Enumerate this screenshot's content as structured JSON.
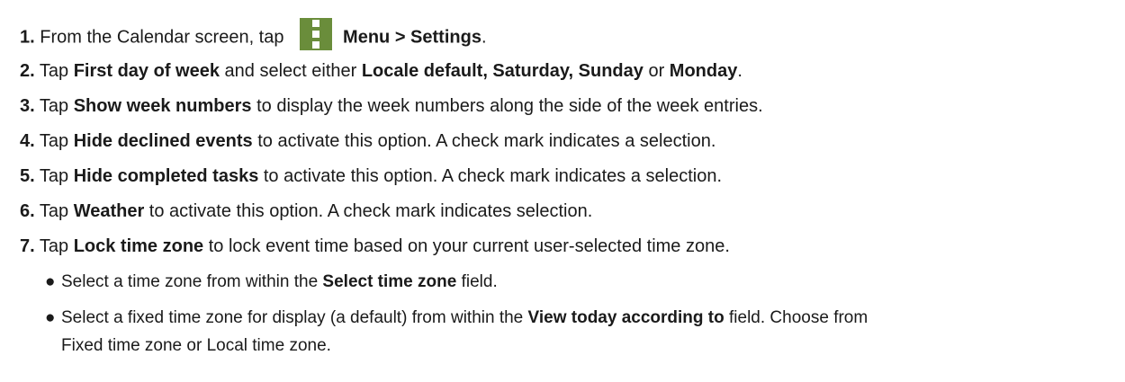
{
  "steps": [
    {
      "num": "1.",
      "t1": " From the Calendar screen, tap ",
      "icon": "menu-icon",
      "b1": "Menu > Settings",
      "t2": "."
    },
    {
      "num": "2.",
      "t1": " Tap ",
      "b1": "First day of week",
      "t2": " and select either ",
      "b2": "Locale default, Saturday, Sunday",
      "t3": " or ",
      "b3": "Monday",
      "t4": "."
    },
    {
      "num": "3.",
      "t1": " Tap ",
      "b1": "Show week numbers",
      "t2": " to display the week numbers along the side of the week entries."
    },
    {
      "num": "4.",
      "t1": " Tap ",
      "b1": "Hide declined events",
      "t2": " to activate this option. A check mark indicates a selection."
    },
    {
      "num": "5.",
      "t1": " Tap ",
      "b1": "Hide completed tasks",
      "t2": " to activate this option. A check mark indicates a selection."
    },
    {
      "num": "6.",
      "t1": " Tap ",
      "b1": "Weather",
      "t2": " to activate this option. A check mark indicates selection."
    },
    {
      "num": "7.",
      "t1": " Tap ",
      "b1": "Lock time zone",
      "t2": " to lock event time based on your current user-selected time zone."
    }
  ],
  "bullets": [
    {
      "t1": "Select a time zone from within the ",
      "b1": "Select time zone",
      "t2": " field."
    },
    {
      "t1": "Select a fixed time zone for display (a default) from within the ",
      "b1": "View today according to",
      "t2": " field. Choose from",
      "line2": "Fixed time zone or Local time zone."
    }
  ],
  "bullet_glyph": "●",
  "colors": {
    "menu_icon_bg": "#6a8d3b",
    "text": "#1a1a1a"
  }
}
